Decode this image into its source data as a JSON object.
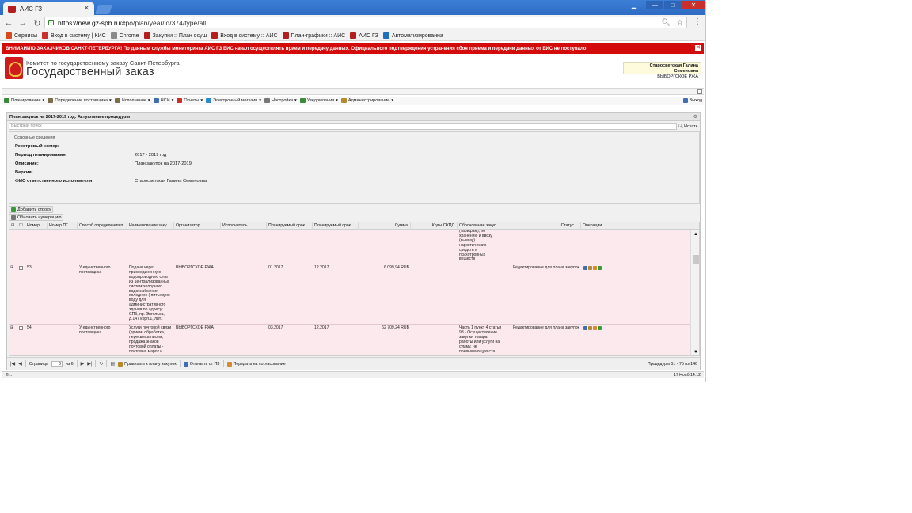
{
  "browser": {
    "tab_title": "АИС ГЗ",
    "url_host": "https://new.gz-spb.ru",
    "url_path": "/#po/plan/year/id/374/type/all",
    "bookmarks": [
      {
        "label": "Сервисы",
        "color": "#d64a1e"
      },
      {
        "label": "Вход в систему | КИС",
        "color": "#c9302c"
      },
      {
        "label": "Chrome",
        "color": "#8a8a8a"
      },
      {
        "label": "Закупки :: План осуш",
        "color": "#b51e1e"
      },
      {
        "label": "Вход в систему :: АИС",
        "color": "#b51e1e"
      },
      {
        "label": "План-графики :: АИС",
        "color": "#b51e1e"
      },
      {
        "label": "АИС ГЗ",
        "color": "#b51e1e"
      },
      {
        "label": "Автоматизированна",
        "color": "#1f6fbf"
      }
    ]
  },
  "warning": {
    "text": "ВНИМАНИЮ ЗАКАЗЧИКОВ САНКТ-ПЕТЕРБУРГА! По данным службы мониторинга АИС ГЗ ЕИС начал осуществлять прием и передачу данных. Официального подтверждения устранения сбоя приема и передачи данных от ЕИС не поступало"
  },
  "header": {
    "org": "Комитет по государственному заказу Санкт-Петербурга",
    "title": "Государственный заказ",
    "user_name": "Старосветская Галина Семеновна",
    "user_org": "ВЫБОРГСКОЕ РЖА"
  },
  "menu": {
    "items": [
      {
        "label": "Планирование",
        "color": "#3a8a3a"
      },
      {
        "label": "Определение поставщика",
        "color": "#7a6f4a"
      },
      {
        "label": "Исполнение",
        "color": "#7a6f4a"
      },
      {
        "label": "НСИ",
        "color": "#3f6fb0"
      },
      {
        "label": "Отчеты",
        "color": "#c9302c"
      },
      {
        "label": "Электронный магазин",
        "color": "#2d8ac9"
      },
      {
        "label": "Настройки",
        "color": "#777777"
      },
      {
        "label": "Уведомления",
        "color": "#3a8a3a"
      },
      {
        "label": "Администрирование",
        "color": "#b58a2d"
      }
    ],
    "logout": "Выход"
  },
  "panel": {
    "title": "План закупок на 2017-2019 год: Актуальные процедуры",
    "search_placeholder": "Быстрый поиск",
    "search_button": "Искать",
    "legend": "Основные сведения",
    "fields": [
      {
        "label": "Реестровый номер:",
        "value": ""
      },
      {
        "label": "Период планирования:",
        "value": "2017 - 2019 год"
      },
      {
        "label": "Описание:",
        "value": "План закупок на 2017-2019"
      },
      {
        "label": "Версия:",
        "value": ""
      },
      {
        "label": "ФИО ответственного исполнителя:",
        "value": "Старосветская Галина Семеновна"
      }
    ],
    "add_row": "Добавить строку",
    "renumber": "Обновить нумерацию"
  },
  "grid": {
    "columns": [
      "Номер",
      "Номер ПГ",
      "Способ определения п...",
      "Наименование заку...",
      "Организатор",
      "Исполнитель",
      "Планируемый срок ...",
      "Планируемый срок ...",
      "Сумма",
      "Коды ОКПД",
      "Обоснование закуп...",
      "Статус",
      "Операции"
    ],
    "top_continuation": "(тарифам), по\nхранению и ввозу\n(вывозу)\nнаркотических\nсредств и\nпсихотропных\nвеществ",
    "rows": [
      {
        "number": "53",
        "method": "У единственного\nпоставщика",
        "name": "Подача через\nприсоединенную\nводопроводную сеть\nиз централизованных\nсистем холодного\nводоснабжения\nхолодную ( питьевую)\nводу для\nадминистративного\nздания по адресу:\nСПб, пр. Энгельса,\nд.147 корп.1, лит.Г",
        "organizer": "ВЫБОРГСКОЕ РЖА",
        "executor": "",
        "plan_start": "01.2017",
        "plan_end": "12.2017",
        "sum": "6 099,94 RUB",
        "okpd": "",
        "justification": "",
        "status": "Редактирование для плана закупок"
      },
      {
        "number": "54",
        "method": "У единственного\nпоставщика",
        "name": "Услуги почтовой связи\n(прием, обработка,\nпересылка писем,\nпродажа знаков\nпочтовой оплаты -\nпочтовых марок и",
        "organizer": "ВЫБОРГСКОЕ РЖА",
        "executor": "",
        "plan_start": "03.2017",
        "plan_end": "12.2017",
        "sum": "62 709,24 RUB",
        "okpd": "",
        "justification": "Часть 1 пункт 4 статьи\n93 - Осуществление\nзакупки товара,\nработы или услуги на\nсумму, не\nпревышающую ста",
        "status": "Редактирование для плана закупок"
      }
    ]
  },
  "paging": {
    "page_label": "Страница",
    "page": "3",
    "of": "из 6",
    "attach": "Привязать к плану закупок",
    "detach": "Отвязать от ПЗ",
    "send": "Передать на согласование",
    "info": "Процедуры 51 - 75 из 146"
  },
  "status": {
    "left": "©...",
    "right": "17 Нояб 14:12"
  }
}
